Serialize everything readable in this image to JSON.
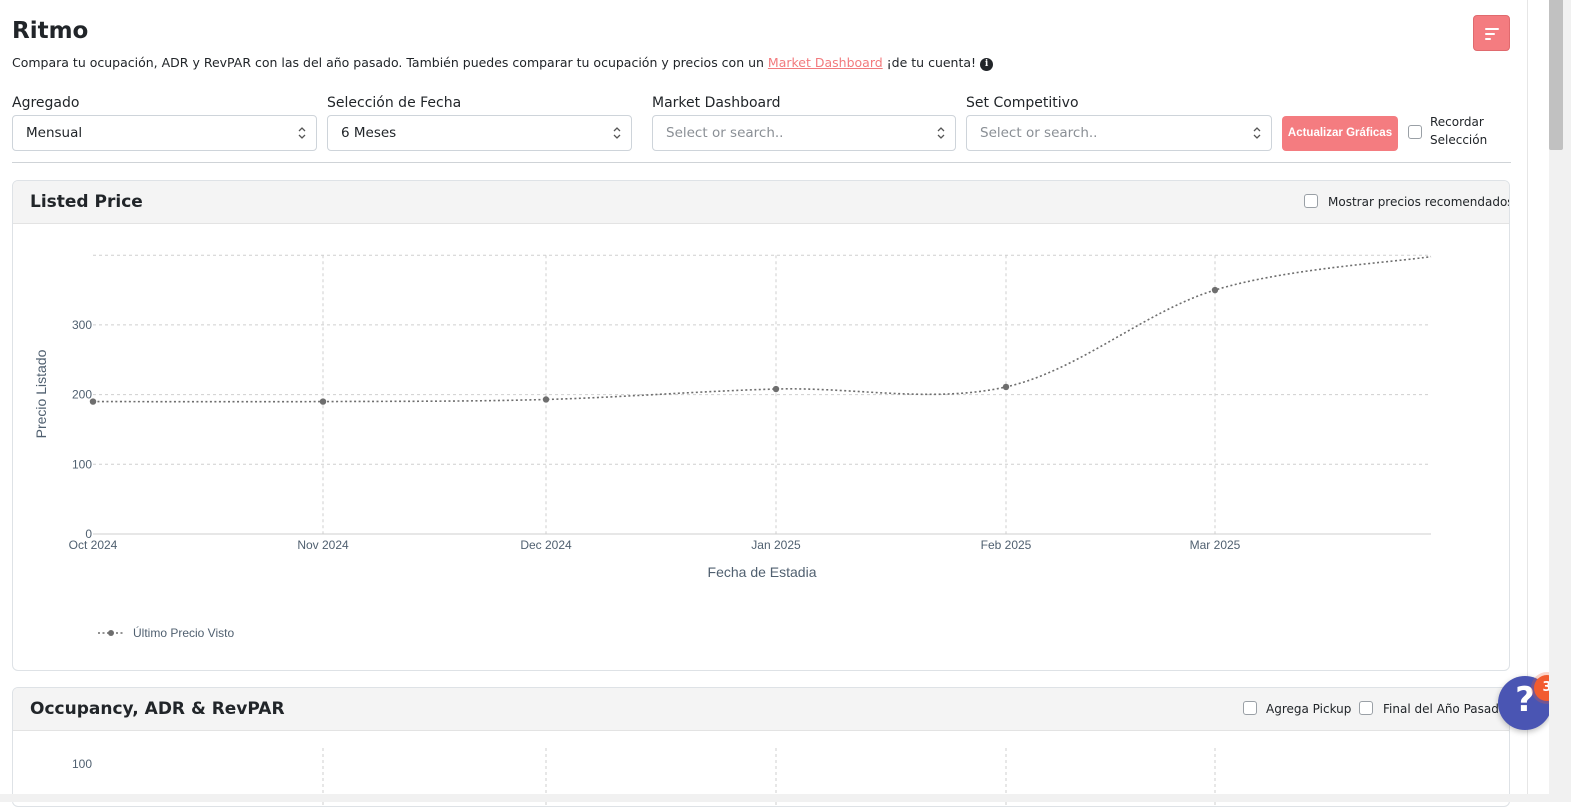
{
  "page": {
    "title": "Ritmo",
    "subtitle_before": "Compara tu ocupación, ADR y RevPAR con las del año pasado. También puedes comparar tu ocupación y precios con un ",
    "subtitle_link": "Market Dashboard",
    "subtitle_after": " ¡de tu cuenta!",
    "info_icon_glyph": "i"
  },
  "filters": {
    "agregado": {
      "label": "Agregado",
      "value": "Mensual"
    },
    "fecha": {
      "label": "Selección de Fecha",
      "value": "6 Meses"
    },
    "market": {
      "label": "Market Dashboard",
      "placeholder": "Select or search.."
    },
    "set": {
      "label": "Set Competitivo",
      "placeholder": "Select or search.."
    },
    "update_button": "Actualizar Gráficas",
    "remember_line1": "Recordar",
    "remember_line2": "Selección"
  },
  "listed_price": {
    "title": "Listed Price",
    "checkbox_label": "Mostrar precios recomendados"
  },
  "occupancy": {
    "title": "Occupancy, ADR & RevPAR",
    "cb_pickup": "Agrega Pickup",
    "cb_final": "Final del Año Pasado",
    "visible_y_tick": "100"
  },
  "chart_data": {
    "type": "line",
    "xlabel": "Fecha de Estadia",
    "ylabel": "Precio Listado",
    "x_ticks": [
      "Oct 2024",
      "Nov 2024",
      "Dec 2024",
      "Jan 2025",
      "Feb 2025",
      "Mar 2025"
    ],
    "y_ticks": [
      0,
      100,
      200,
      300
    ],
    "ylim": [
      0,
      400
    ],
    "grid": true,
    "legend_position": "bottom-left",
    "series": [
      {
        "name": "Último Precio Visto",
        "color": "#6e6e6e",
        "style": "dotted",
        "x": [
          "Oct 2024",
          "Nov 2024",
          "Dec 2024",
          "Jan 2025",
          "Feb 2025",
          "Mar 2025"
        ],
        "values": [
          190,
          190,
          193,
          208,
          211,
          350
        ],
        "tail_value": 398
      }
    ]
  },
  "help": {
    "glyph": "?",
    "badge_count": "3"
  },
  "colors": {
    "accent": "#f47c80",
    "help": "#4a55b3",
    "badge": "#f25c2f"
  }
}
